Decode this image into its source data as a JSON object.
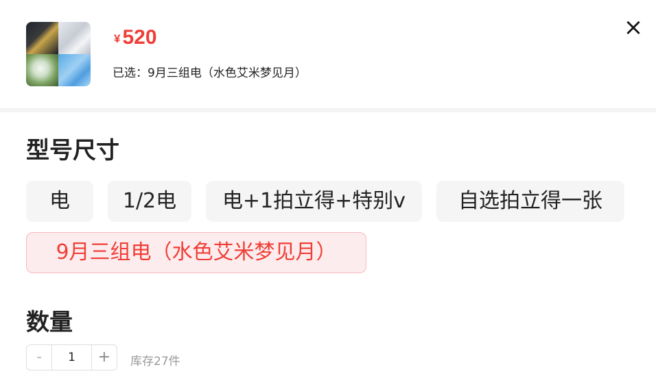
{
  "header": {
    "price_symbol": "¥",
    "price": "520",
    "selected_text": "已选：9月三组电（水色艾米梦见月）",
    "close_icon": "×"
  },
  "spec": {
    "title": "型号尺寸",
    "options": [
      {
        "label": "电",
        "selected": false
      },
      {
        "label": "1/2电",
        "selected": false
      },
      {
        "label": "电+1拍立得+特别v",
        "selected": false
      },
      {
        "label": "自选拍立得一张",
        "selected": false
      },
      {
        "label": "9月三组电（水色艾米梦见月）",
        "selected": true
      }
    ]
  },
  "quantity": {
    "title": "数量",
    "minus": "-",
    "value": "1",
    "plus": "+",
    "stock": "库存27件"
  },
  "colors": {
    "accent": "#ef3e35",
    "selected_bg": "#fdecee",
    "option_bg": "#f5f5f5"
  }
}
